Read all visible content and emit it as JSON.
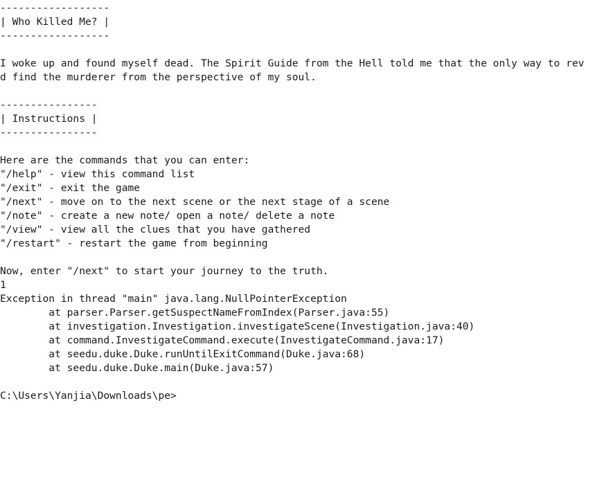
{
  "console": {
    "lines": [
      "------------------",
      "| Who Killed Me? |",
      "------------------",
      "",
      "I woke up and found myself dead. The Spirit Guide from the Hell told me that the only way to rev",
      "d find the murderer from the perspective of my soul.",
      "",
      "----------------",
      "| Instructions |",
      "----------------",
      "",
      "Here are the commands that you can enter:",
      "\"/help\" - view this command list",
      "\"/exit\" - exit the game",
      "\"/next\" - move on to the next scene or the next stage of a scene",
      "\"/note\" - create a new note/ open a note/ delete a note",
      "\"/view\" - view all the clues that you have gathered",
      "\"/restart\" - restart the game from beginning",
      "",
      "Now, enter \"/next\" to start your journey to the truth.",
      "1",
      "Exception in thread \"main\" java.lang.NullPointerException",
      "        at parser.Parser.getSuspectNameFromIndex(Parser.java:55)",
      "        at investigation.Investigation.investigateScene(Investigation.java:40)",
      "        at command.InvestigateCommand.execute(InvestigateCommand.java:17)",
      "        at seedu.duke.Duke.runUntilExitCommand(Duke.java:68)",
      "        at seedu.duke.Duke.main(Duke.java:57)",
      "",
      "C:\\Users\\Yanjia\\Downloads\\pe>"
    ]
  },
  "colors": {
    "background": "#ffffff",
    "text": "#1a1a1a"
  }
}
